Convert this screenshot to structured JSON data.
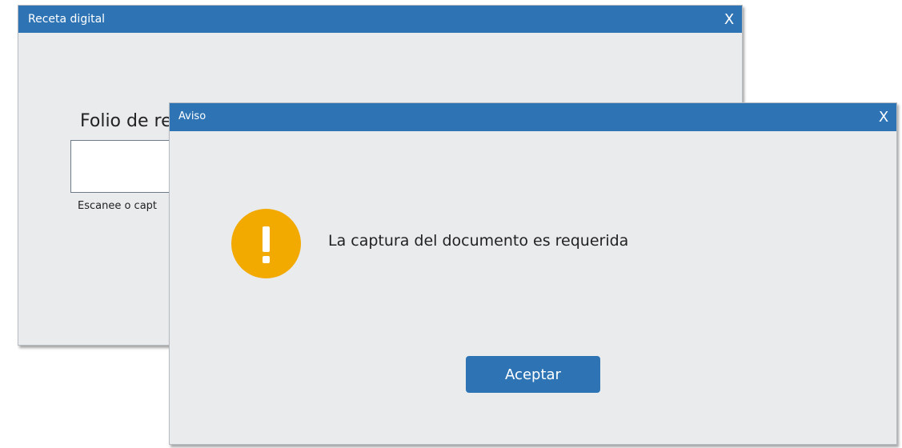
{
  "back_window": {
    "title": "Receta digital",
    "close_label": "X",
    "folio_label": "Folio de re",
    "folio_value": "",
    "hint": "Escanee o capt"
  },
  "dialog": {
    "title": "Aviso",
    "close_label": "X",
    "icon": "warning-icon",
    "icon_glyph": "!",
    "message": "La captura del documento es requerida",
    "accept_label": "Aceptar"
  },
  "colors": {
    "titlebar": "#2e74b5",
    "window_bg": "#e9ebed",
    "warning": "#f2a900",
    "button": "#2e74b5"
  }
}
